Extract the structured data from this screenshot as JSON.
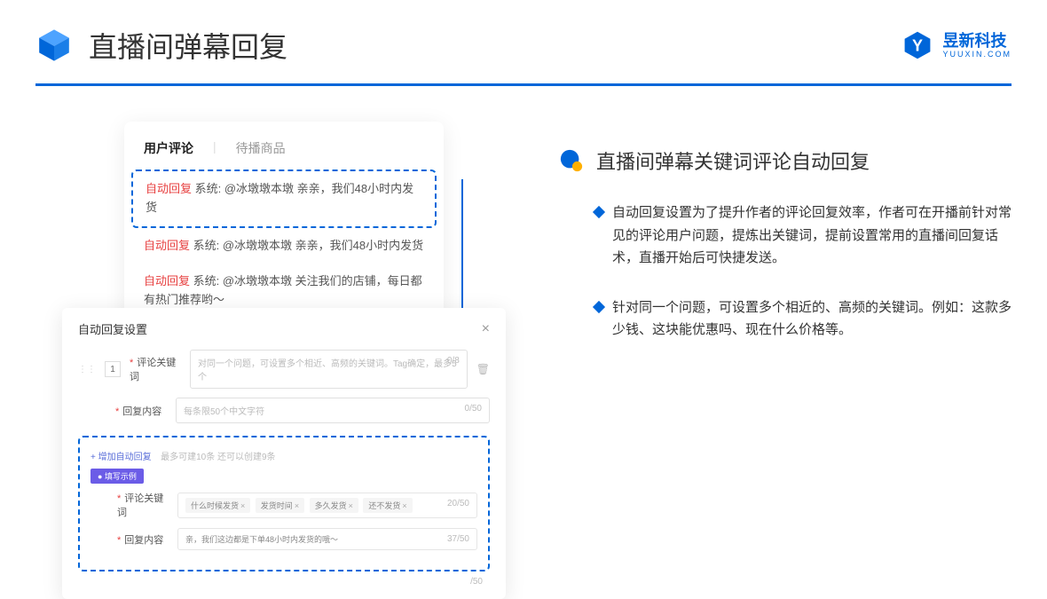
{
  "header": {
    "title": "直播间弹幕回复",
    "brand_cn": "昱新科技",
    "brand_en": "YUUXIN.COM"
  },
  "comment_panel": {
    "tab_active": "用户评论",
    "tab_inactive": "待播商品",
    "replies": [
      {
        "label": "自动回复",
        "text": "系统: @冰墩墩本墩 亲亲，我们48小时内发货"
      },
      {
        "label": "自动回复",
        "text": "系统: @冰墩墩本墩 亲亲，我们48小时内发货"
      },
      {
        "label": "自动回复",
        "text": "系统: @冰墩墩本墩 关注我们的店铺，每日都有热门推荐哟～"
      }
    ]
  },
  "settings": {
    "title": "自动回复设置",
    "row_num": "1",
    "keyword_label": "评论关键词",
    "keyword_placeholder": "对同一个问题，可设置多个相近、高频的关键词。Tag确定，最多5个",
    "keyword_count": "0/8",
    "content_label": "回复内容",
    "content_placeholder": "每条限50个中文字符",
    "content_count": "0/50",
    "add_link": "+ 增加自动回复",
    "add_hint": "最多可建10条 还可以创建9条",
    "example_badge": "● 填写示例",
    "ex_keyword_label": "评论关键词",
    "ex_tags": [
      "什么时候发货",
      "发货时间",
      "多久发货",
      "还不发货"
    ],
    "ex_keyword_count": "20/50",
    "ex_content_label": "回复内容",
    "ex_content_text": "亲，我们这边都是下单48小时内发货的哦～",
    "ex_content_count": "37/50",
    "outer_count": "/50"
  },
  "right": {
    "section_title": "直播间弹幕关键词评论自动回复",
    "bullets": [
      "自动回复设置为了提升作者的评论回复效率，作者可在开播前针对常见的评论用户问题，提炼出关键词，提前设置常用的直播间回复话术，直播开始后可快捷发送。",
      "针对同一个问题，可设置多个相近的、高频的关键词。例如：这款多少钱、这块能优惠吗、现在什么价格等。"
    ]
  }
}
